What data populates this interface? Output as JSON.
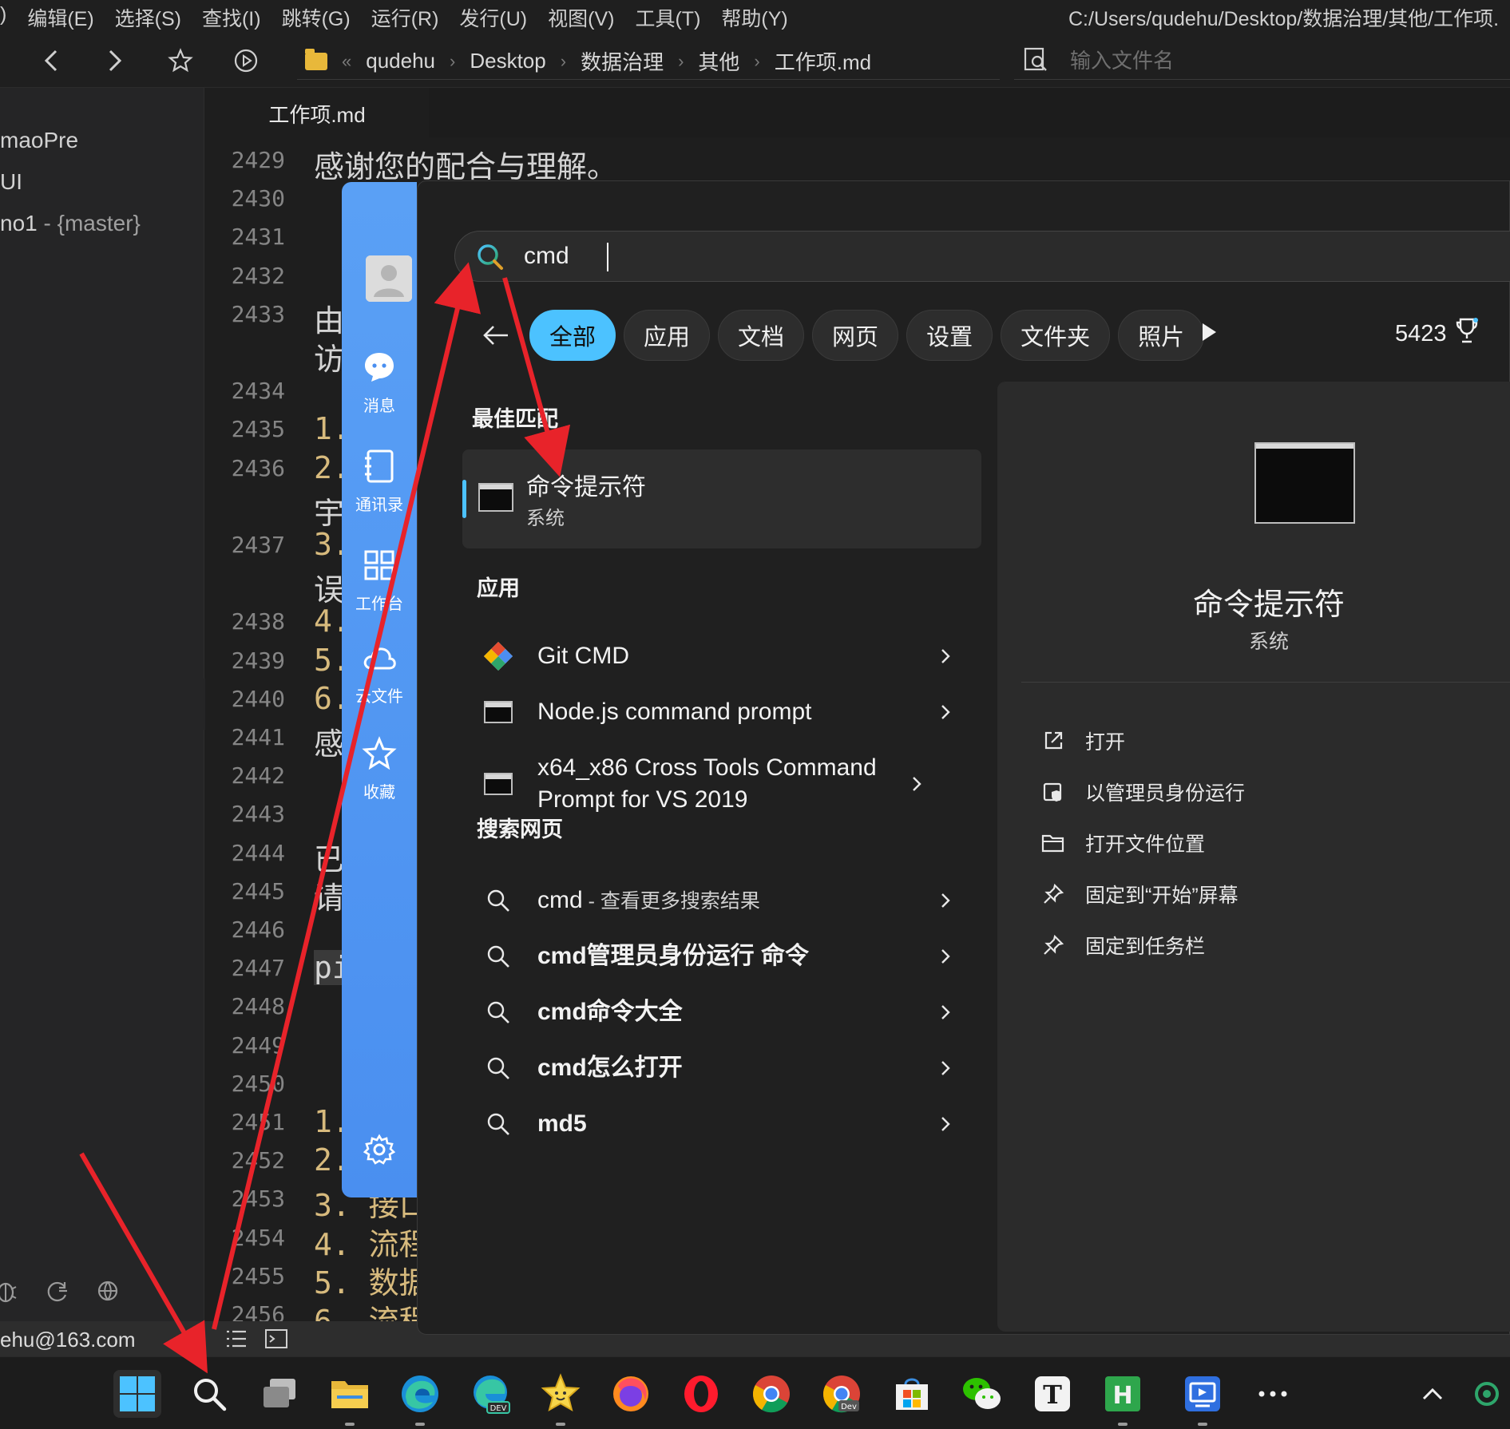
{
  "menubar": {
    "items": [
      "编辑(E)",
      "选择(S)",
      "查找(I)",
      "跳转(G)",
      "运行(R)",
      "发行(U)",
      "视图(V)",
      "工具(T)",
      "帮助(Y)"
    ],
    "path": "C:/Users/qudehu/Desktop/数据治理/其他/工作项."
  },
  "breadcrumb": [
    "qudehu",
    "Desktop",
    "数据治理",
    "其他",
    "工作项.md"
  ],
  "file_search": {
    "placeholder": "输入文件名"
  },
  "sidebar": {
    "projects": [
      {
        "name": "maoPre",
        "branch": ""
      },
      {
        "name": "UI",
        "branch": ""
      },
      {
        "name": "no1",
        "branch": " - {master}"
      }
    ]
  },
  "tab": {
    "label": "工作项.md"
  },
  "editor": {
    "lines": [
      {
        "n": "2429",
        "text": "感谢您的配合与理解。",
        "cls": ""
      },
      {
        "n": "2430",
        "text": "",
        "cls": ""
      },
      {
        "n": "2431",
        "text": "",
        "cls": ""
      },
      {
        "n": "2432",
        "text": "",
        "cls": ""
      },
      {
        "n": "2433",
        "text": "由",
        "cls": ""
      },
      {
        "n": "",
        "text": "访",
        "cls": ""
      },
      {
        "n": "2434",
        "text": "",
        "cls": ""
      },
      {
        "n": "2435",
        "text": "1.",
        "cls": "num"
      },
      {
        "n": "2436",
        "text": "2.",
        "cls": "num"
      },
      {
        "n": "",
        "text": "宇",
        "cls": ""
      },
      {
        "n": "2437",
        "text": "3.",
        "cls": "num"
      },
      {
        "n": "",
        "text": "误",
        "cls": ""
      },
      {
        "n": "2438",
        "text": "4.",
        "cls": "num"
      },
      {
        "n": "2439",
        "text": "5.",
        "cls": "num"
      },
      {
        "n": "2440",
        "text": "6.",
        "cls": "num"
      },
      {
        "n": "2441",
        "text": "感",
        "cls": ""
      },
      {
        "n": "2442",
        "text": "",
        "cls": ""
      },
      {
        "n": "2443",
        "text": "",
        "cls": ""
      },
      {
        "n": "2444",
        "text": "已",
        "cls": ""
      },
      {
        "n": "2445",
        "text": "请",
        "cls": ""
      },
      {
        "n": "2446",
        "text": "",
        "cls": ""
      },
      {
        "n": "2447",
        "text": "pi",
        "cls": "hl"
      },
      {
        "n": "2448",
        "text": "",
        "cls": ""
      },
      {
        "n": "2449",
        "text": "",
        "cls": ""
      },
      {
        "n": "2450",
        "text": "",
        "cls": ""
      },
      {
        "n": "2451",
        "text": "1.",
        "cls": "num"
      },
      {
        "n": "2452",
        "text": "2.",
        "cls": "num"
      },
      {
        "n": "2453",
        "text": "3. 接口",
        "cls": "num"
      },
      {
        "n": "2454",
        "text": "4. 流程",
        "cls": "num"
      },
      {
        "n": "2455",
        "text": "5. 数据",
        "cls": "num"
      },
      {
        "n": "2456",
        "text": "6. 流程",
        "cls": "num"
      }
    ]
  },
  "statusbar": {
    "account": "ehu@163.com"
  },
  "qq_panel": {
    "items": [
      "消息",
      "通讯录",
      "工作台",
      "云文件",
      "收藏"
    ]
  },
  "search": {
    "query": "cmd",
    "filters": [
      "全部",
      "应用",
      "文档",
      "网页",
      "设置",
      "文件夹",
      "照片"
    ],
    "points": "5423",
    "best_match_header": "最佳匹配",
    "best_match": {
      "title": "命令提示符",
      "subtitle": "系统"
    },
    "apps_header": "应用",
    "apps": [
      {
        "label": "Git CMD"
      },
      {
        "label": "Node.js command prompt"
      },
      {
        "label": "x64_x86 Cross Tools Command Prompt for VS 2019"
      }
    ],
    "web_header": "搜索网页",
    "web": [
      {
        "main": "cmd",
        "suffix": " - 查看更多搜索结果"
      },
      {
        "main": "cmd管理员身份运行 命令",
        "suffix": ""
      },
      {
        "main": "cmd命令大全",
        "suffix": ""
      },
      {
        "main": "cmd怎么打开",
        "suffix": ""
      },
      {
        "main": "md5",
        "suffix": ""
      }
    ],
    "preview": {
      "title": "命令提示符",
      "subtitle": "系统",
      "actions": [
        "打开",
        "以管理员身份运行",
        "打开文件位置",
        "固定到“开始”屏幕",
        "固定到任务栏"
      ]
    }
  },
  "colors": {
    "accent": "#4cc2ff",
    "annotation": "#e8232a",
    "qq_blue": "#4a8ff0"
  }
}
